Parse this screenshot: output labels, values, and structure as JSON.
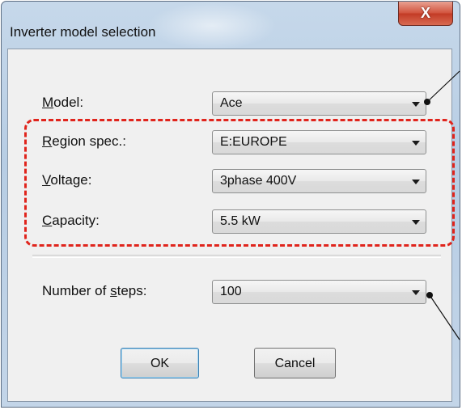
{
  "window": {
    "title": "Inverter model selection",
    "close_glyph": "X"
  },
  "fields": {
    "model": {
      "label_prefix": "",
      "label_accel": "M",
      "label_rest": "odel:",
      "value": "Ace"
    },
    "region": {
      "label_prefix": "",
      "label_accel": "R",
      "label_rest": "egion spec.:",
      "value": "E:EUROPE"
    },
    "voltage": {
      "label_prefix": "",
      "label_accel": "V",
      "label_rest": "oltage:",
      "value": "3phase 400V"
    },
    "capacity": {
      "label_prefix": "",
      "label_accel": "C",
      "label_rest": "apacity:",
      "value": "5.5 kW"
    },
    "steps": {
      "label_prefix": "Number of ",
      "label_accel": "s",
      "label_rest": "teps:",
      "value": "100"
    }
  },
  "buttons": {
    "ok": "OK",
    "cancel": "Cancel"
  },
  "colors": {
    "highlight_dash": "#e0241c",
    "close_button": "#c33b26"
  },
  "icons": {
    "close": "close-icon",
    "dropdown": "chevron-down-icon"
  }
}
